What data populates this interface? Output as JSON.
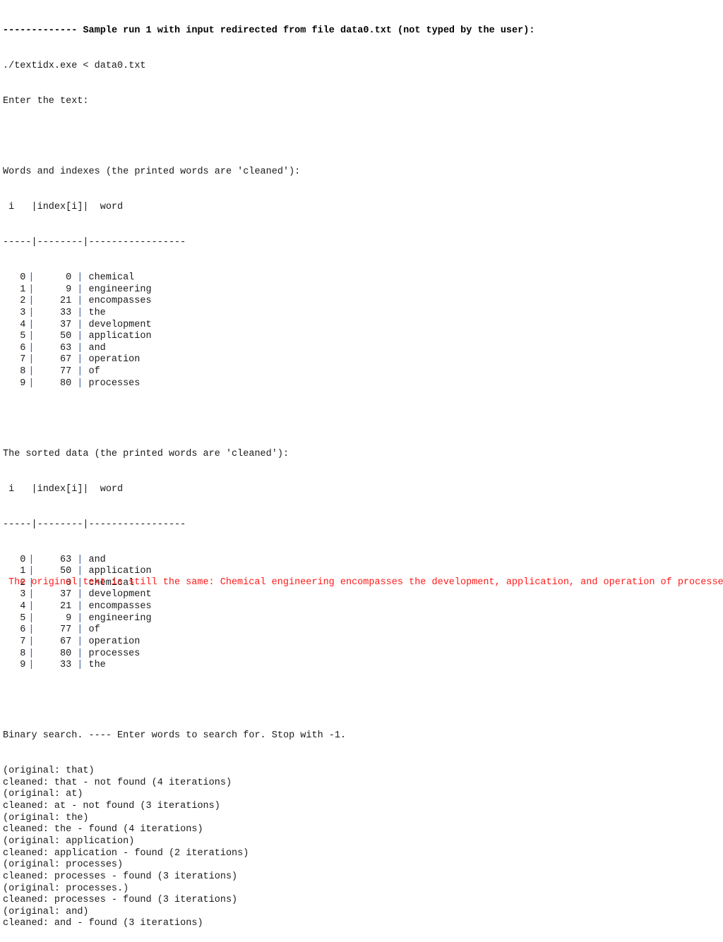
{
  "header": {
    "dashes": "-------------",
    "title": "Sample run 1 with input redirected from file data0.txt (not typed by the user):",
    "command": "./textidx.exe < data0.txt",
    "prompt": "Enter the text:"
  },
  "words_table": {
    "heading": "Words and indexes (the printed words are 'cleaned'):",
    "header_row": " i   |index[i]|  word",
    "separator": "-----|--------|-----------------",
    "rows": [
      {
        "i": "0",
        "index": "0",
        "word": "chemical"
      },
      {
        "i": "1",
        "index": "9",
        "word": "engineering"
      },
      {
        "i": "2",
        "index": "21",
        "word": "encompasses"
      },
      {
        "i": "3",
        "index": "33",
        "word": "the"
      },
      {
        "i": "4",
        "index": "37",
        "word": "development"
      },
      {
        "i": "5",
        "index": "50",
        "word": "application"
      },
      {
        "i": "6",
        "index": "63",
        "word": "and"
      },
      {
        "i": "7",
        "index": "67",
        "word": "operation"
      },
      {
        "i": "8",
        "index": "77",
        "word": "of"
      },
      {
        "i": "9",
        "index": "80",
        "word": "processes"
      }
    ]
  },
  "sorted_table": {
    "heading": "The sorted data (the printed words are 'cleaned'):",
    "header_row": " i   |index[i]|  word",
    "separator": "-----|--------|-----------------",
    "rows": [
      {
        "i": "0",
        "index": "63",
        "word": "and"
      },
      {
        "i": "1",
        "index": "50",
        "word": "application"
      },
      {
        "i": "2",
        "index": "0",
        "word": "chemical"
      },
      {
        "i": "3",
        "index": "37",
        "word": "development"
      },
      {
        "i": "4",
        "index": "21",
        "word": "encompasses"
      },
      {
        "i": "5",
        "index": "9",
        "word": "engineering"
      },
      {
        "i": "6",
        "index": "77",
        "word": "of"
      },
      {
        "i": "7",
        "index": "67",
        "word": "operation"
      },
      {
        "i": "8",
        "index": "80",
        "word": "processes"
      },
      {
        "i": "9",
        "index": "33",
        "word": "the"
      }
    ]
  },
  "binary_search": {
    "heading": "Binary search. ---- Enter words to search for. Stop with -1.",
    "lines": [
      "(original: that)",
      "cleaned: that - not found (4 iterations)",
      "(original: at)",
      "cleaned: at - not found (3 iterations)",
      "(original: the)",
      "cleaned: the - found (4 iterations)",
      "(original: application)",
      "cleaned: application - found (2 iterations)",
      "(original: processes)",
      "cleaned: processes - found (3 iterations)",
      "(original: processes.)",
      "cleaned: processes - found (3 iterations)",
      "(original: and)",
      "cleaned: and - found (3 iterations)"
    ]
  },
  "note": {
    "text": "The original text is still the same: Chemical engineering encompasses the development, application, and operation of processes.",
    "color": "#ff1a1a"
  }
}
